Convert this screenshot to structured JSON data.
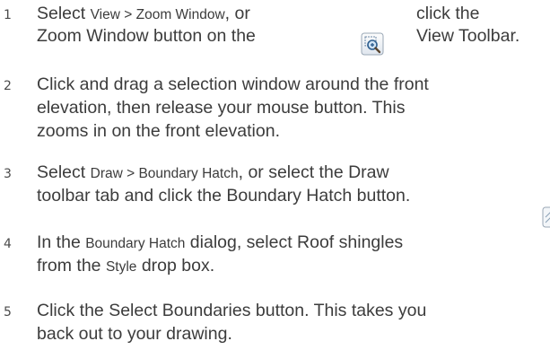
{
  "steps": [
    {
      "number": "1",
      "line1_a": "Select ",
      "line1_menu": "View > Zoom Window",
      "line1_b": ", or",
      "line2": "Zoom Window button on the",
      "right1": "click the",
      "right2": "View Toolbar."
    },
    {
      "number": "2",
      "lines": [
        "Click and drag a selection window around the front",
        "elevation, then release your mouse button. This",
        "zooms in on the front elevation."
      ]
    },
    {
      "number": "3",
      "line1_a": "Select ",
      "line1_menu": "Draw > Boundary Hatch",
      "line1_b": ", or select the Draw",
      "line2": "toolbar tab and click the Boundary Hatch button."
    },
    {
      "number": "4",
      "line1_a": "In the ",
      "line1_dialog": "Boundary Hatch",
      "line1_b": " dialog, select Roof shingles",
      "line2_a": "from the ",
      "line2_style": "Style",
      "line2_b": " drop box."
    },
    {
      "number": "5",
      "lines": [
        "Click the Select Boundaries button. This takes you",
        "back out to your drawing."
      ]
    }
  ],
  "icons": {
    "zoom_window": "zoom-window-icon",
    "boundary_hatch": "boundary-hatch-icon"
  }
}
